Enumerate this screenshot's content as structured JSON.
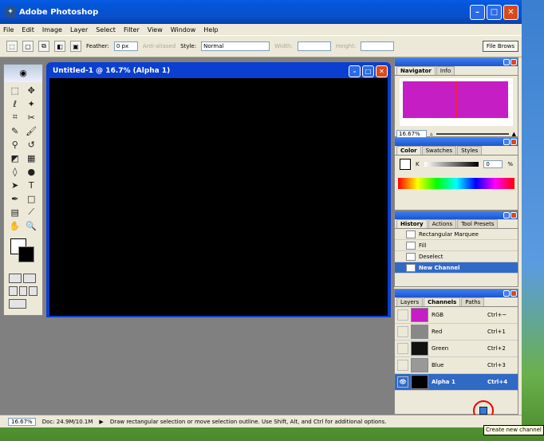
{
  "app": {
    "title": "Adobe Photoshop"
  },
  "menu": [
    "File",
    "Edit",
    "Image",
    "Layer",
    "Select",
    "Filter",
    "View",
    "Window",
    "Help"
  ],
  "options": {
    "feather_label": "Feather:",
    "feather_value": "0 px",
    "antialiased_label": "Anti-aliased",
    "style_label": "Style:",
    "style_value": "Normal",
    "width_label": "Width:",
    "height_label": "Height:",
    "file_browser_label": "File Brows"
  },
  "document": {
    "title": "Untitled-1 @ 16.7% (Alpha 1)",
    "canvas_color": "#000000"
  },
  "navigator": {
    "tabs": [
      "Navigator",
      "Info"
    ],
    "zoom": "16.67%"
  },
  "color": {
    "tabs": [
      "Color",
      "Swatches",
      "Styles"
    ],
    "channel_label": "K",
    "value": "0",
    "unit": "%"
  },
  "history": {
    "tabs": [
      "History",
      "Actions",
      "Tool Presets"
    ],
    "items": [
      "Rectangular Marquee",
      "Fill",
      "Deselect",
      "New Channel"
    ],
    "selected": "New Channel"
  },
  "channels": {
    "tabs": [
      "Layers",
      "Channels",
      "Paths"
    ],
    "rows": [
      {
        "name": "RGB",
        "shortcut": "Ctrl+~"
      },
      {
        "name": "Red",
        "shortcut": "Ctrl+1"
      },
      {
        "name": "Green",
        "shortcut": "Ctrl+2"
      },
      {
        "name": "Blue",
        "shortcut": "Ctrl+3"
      },
      {
        "name": "Alpha 1",
        "shortcut": "Ctrl+4"
      }
    ],
    "selected": "Alpha 1"
  },
  "status": {
    "zoom": "16.67%",
    "doc": "Doc: 24.9M/10.1M",
    "hint": "Draw rectangular selection or move selection outline. Use Shift, Alt, and Ctrl for additional options."
  },
  "tooltip": "Create new channel",
  "colors": {
    "accent": "#316ac5",
    "title_blue": "#0a4fcc",
    "magenta": "#c41ec4"
  }
}
